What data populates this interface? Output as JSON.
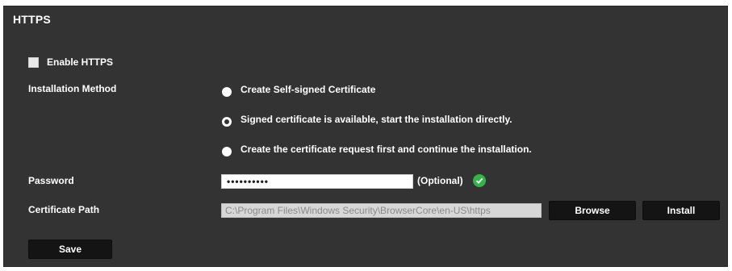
{
  "section": {
    "title": "HTTPS"
  },
  "enable": {
    "label": "Enable HTTPS",
    "checked": true
  },
  "installation": {
    "label": "Installation Method",
    "options": [
      {
        "label": "Create Self-signed Certificate",
        "selected": false
      },
      {
        "label": "Signed certificate is available, start the installation directly.",
        "selected": true
      },
      {
        "label": "Create the certificate request first and continue the installation.",
        "selected": false
      }
    ]
  },
  "password": {
    "label": "Password",
    "value": "••••••••••",
    "hint": "(Optional)",
    "status_icon": "check-circle-icon"
  },
  "certificate": {
    "label": "Certificate Path",
    "value": "C:\\Program Files\\Windows Security\\BrowserCore\\en-US\\https",
    "browse_label": "Browse",
    "install_label": "Install"
  },
  "save_label": "Save",
  "colors": {
    "panel": "#333333",
    "button": "#141414",
    "ok": "#35b34a"
  }
}
